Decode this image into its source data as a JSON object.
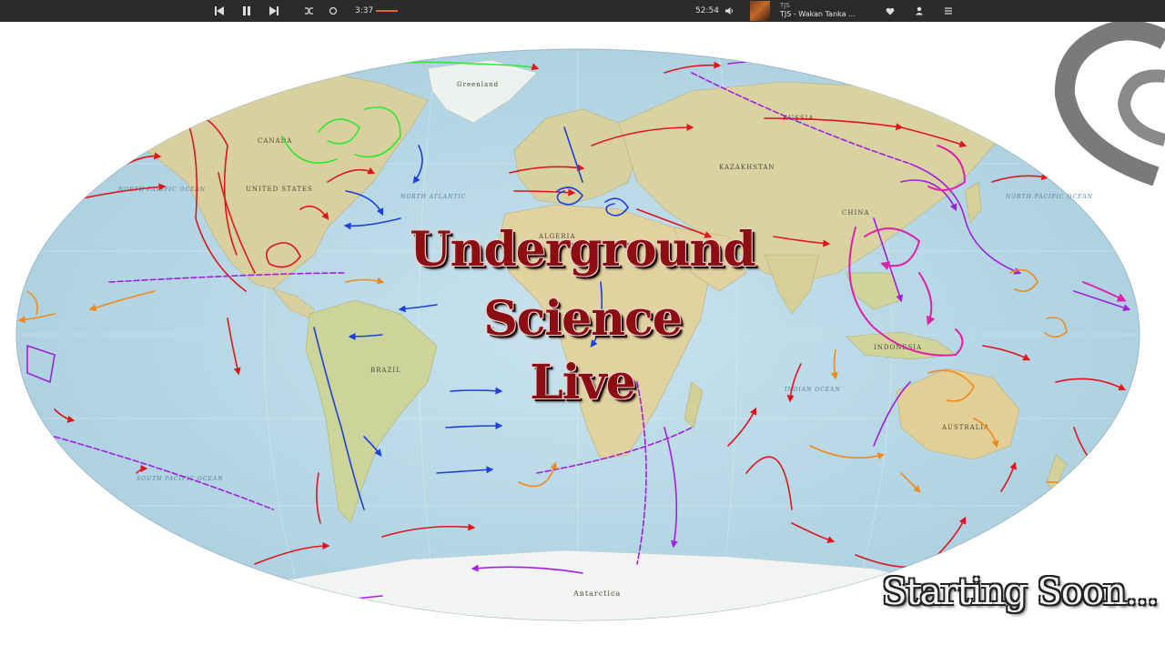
{
  "player": {
    "elapsed": "3:37",
    "duration": "52:54",
    "artist": "TJS",
    "track": "TJS - Wakan Tanka ...",
    "progress": 0.07,
    "icons": [
      "skip-previous-icon",
      "pause-icon",
      "skip-next-icon",
      "shuffle-icon",
      "repeat-icon",
      "volume-icon",
      "heart-icon",
      "user-icon",
      "queue-icon"
    ]
  },
  "map": {
    "labels": {
      "greenland": "Greenland",
      "canada": "CANADA",
      "united_states": "UNITED STATES",
      "russia": "RUSSIA",
      "kazakhstan": "KAZAKHSTAN",
      "china": "CHINA",
      "algeria": "ALGERIA",
      "brazil": "BRAZIL",
      "australia": "AUSTRALIA",
      "antarctica": "Antarctica",
      "indonesia": "INDONESIA",
      "north_atlantic": "NORTH ATLANTIC",
      "north_pacific_left": "NORTH PACIFIC OCEAN",
      "north_pacific_right": "NORTH PACIFIC OCEAN",
      "south_pacific": "SOUTH PACIFIC OCEAN",
      "indian_ocean": "INDIAN OCEAN"
    },
    "colors": {
      "ocean": "#bcd9e6",
      "land": "#d9d2a4",
      "arrow_red": "#e0141b",
      "arrow_purple": "#a11fe0",
      "arrow_blue": "#1d3fdc",
      "arrow_orange": "#f08a1c",
      "arrow_green": "#2ee82e",
      "arrow_magenta": "#e01fa8"
    }
  },
  "overlay": {
    "title_line1": "Underground",
    "title_line2": "Science",
    "title_line3": "Live",
    "status": "Starting Soon..."
  }
}
